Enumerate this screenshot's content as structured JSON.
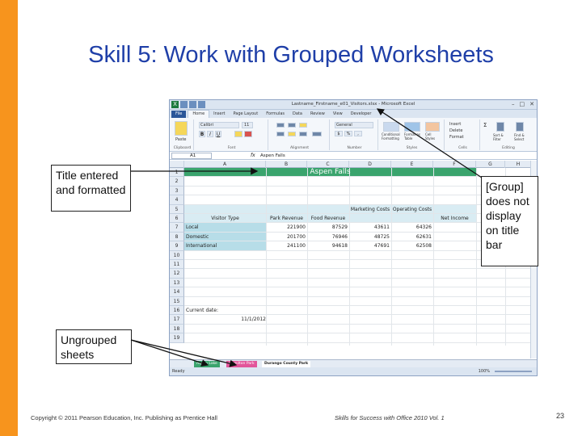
{
  "slide": {
    "title": "Skill 5: Work with Grouped Worksheets",
    "footer_left": "Copyright © 2011 Pearson Education, Inc. Publishing as Prentice Hall",
    "footer_middle": "Skills for Success with Office 2010 Vol. 1",
    "page_number": "23",
    "accent_color": "#f7941d",
    "title_color": "#1f3fa8"
  },
  "callouts": {
    "title_entered": "Title entered and formatted",
    "group_title": "[Group] does not display on title bar",
    "ungrouped": "Ungrouped sheets"
  },
  "excel": {
    "window_title": "Lastname_Firstname_e01_Visitors.xlsx - Microsoft Excel",
    "tabs": [
      "File",
      "Home",
      "Insert",
      "Page Layout",
      "Formulas",
      "Data",
      "Review",
      "View",
      "Developer"
    ],
    "active_tab": "Home",
    "ribbon": {
      "paste": "Paste",
      "font_name": "Calibri",
      "font_size": "11",
      "number_format": "General",
      "conditional_formatting": "Conditional Formatting",
      "format_as_table": "Format as Table",
      "cell_styles": "Cell Styles",
      "insert": "Insert",
      "delete": "Delete",
      "format": "Format",
      "sort_filter": "Sort & Filter",
      "find_select": "Find & Select",
      "groups": [
        "Clipboard",
        "Font",
        "Alignment",
        "Number",
        "Styles",
        "Cells",
        "Editing"
      ]
    },
    "name_box": "A1",
    "fx": "fx",
    "formula_value": "Aspen Falls",
    "columns": [
      "A",
      "B",
      "C",
      "D",
      "E",
      "F",
      "G",
      "H"
    ],
    "rows": [
      "1",
      "2",
      "3",
      "4",
      "5",
      "6",
      "7",
      "8",
      "9",
      "10",
      "11",
      "12",
      "13",
      "14",
      "15",
      "16",
      "17",
      "18",
      "19"
    ],
    "title_cell": "Aspen Falls",
    "headers": {
      "visitor_type": "Visitor Type",
      "park_revenue": "Park Revenue",
      "food_revenue": "Food Revenue",
      "marketing_costs": "Marketing Costs",
      "operating_costs": "Operating Costs",
      "net_income": "Net Income"
    },
    "data_rows": [
      {
        "type": "Local",
        "park": "221900",
        "food": "87529",
        "marketing": "43611",
        "operating": "64326"
      },
      {
        "type": "Domestic",
        "park": "201700",
        "food": "76946",
        "marketing": "48725",
        "operating": "62631"
      },
      {
        "type": "International",
        "park": "241100",
        "food": "94618",
        "marketing": "47691",
        "operating": "62508"
      }
    ],
    "current_date_label": "Current date:",
    "current_date_value": "11/1/2012",
    "sheet_tabs": [
      "Aspen Lake",
      "Hamilton Park",
      "Durango County Park"
    ],
    "status": "Ready",
    "zoom": "100%"
  }
}
